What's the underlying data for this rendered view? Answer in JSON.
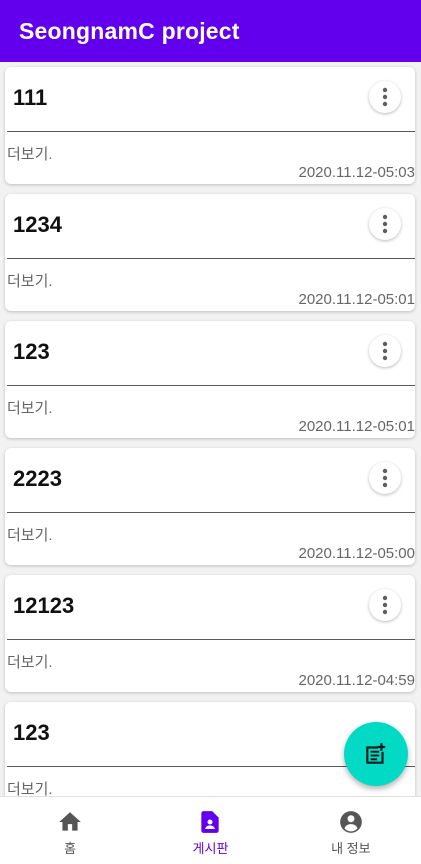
{
  "app_bar": {
    "title": "SeongnamC project"
  },
  "posts": [
    {
      "title": "111",
      "body": "더보기.",
      "date": "2020.11.12-05:03"
    },
    {
      "title": "1234",
      "body": "더보기.",
      "date": "2020.11.12-05:01"
    },
    {
      "title": "123",
      "body": "더보기.",
      "date": "2020.11.12-05:01"
    },
    {
      "title": "2223",
      "body": "더보기.",
      "date": "2020.11.12-05:00"
    },
    {
      "title": "12123",
      "body": "더보기.",
      "date": "2020.11.12-04:59"
    },
    {
      "title": "123",
      "body": "더보기.",
      "date": ""
    }
  ],
  "fab": {
    "icon": "post-add-icon"
  },
  "bottom_nav": {
    "items": [
      {
        "label": "홈",
        "icon": "home-icon",
        "active": false
      },
      {
        "label": "게시판",
        "icon": "document-person-icon",
        "active": true
      },
      {
        "label": "내 정보",
        "icon": "account-circle-icon",
        "active": false
      }
    ]
  },
  "colors": {
    "primary": "#6200ee",
    "secondary": "#03dac5",
    "card_text": "#111111",
    "muted_text": "#666666"
  }
}
